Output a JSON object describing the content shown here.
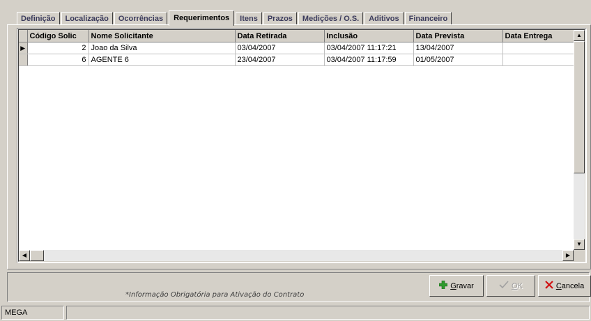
{
  "tabs": [
    {
      "label": "Definição"
    },
    {
      "label": "Localização"
    },
    {
      "label": "Ocorrências"
    },
    {
      "label": "Requerimentos",
      "active": true
    },
    {
      "label": "Itens"
    },
    {
      "label": "Prazos"
    },
    {
      "label": "Medições / O.S."
    },
    {
      "label": "Aditivos"
    },
    {
      "label": "Financeiro"
    }
  ],
  "grid": {
    "columns": [
      "Código Solic",
      "Nome Solicitante",
      "Data Retirada",
      "Inclusão",
      "Data Prevista",
      "Data Entrega"
    ],
    "rows": [
      [
        "2",
        "Joao da Silva",
        "03/04/2007",
        "03/04/2007 11:17:21",
        "13/04/2007",
        ""
      ],
      [
        "6",
        "AGENTE 6",
        "23/04/2007",
        "03/04/2007 11:17:59",
        "01/05/2007",
        ""
      ]
    ],
    "current_row_marker": "▶"
  },
  "footer": {
    "note": "*Informação Obrigatória para Ativação do Contrato",
    "gravar": {
      "label_prefix": "",
      "underline": "G",
      "rest": "ravar",
      "icon": "plus-icon",
      "icon_color": "#2e9a2e"
    },
    "ok": {
      "underline": "O",
      "rest": "K",
      "icon": "check-icon"
    },
    "cancela": {
      "underline": "C",
      "rest": "ancela",
      "icon": "x-icon",
      "icon_color": "#d01010"
    }
  },
  "status": {
    "panel1": "MEGA",
    "panel2": ""
  }
}
